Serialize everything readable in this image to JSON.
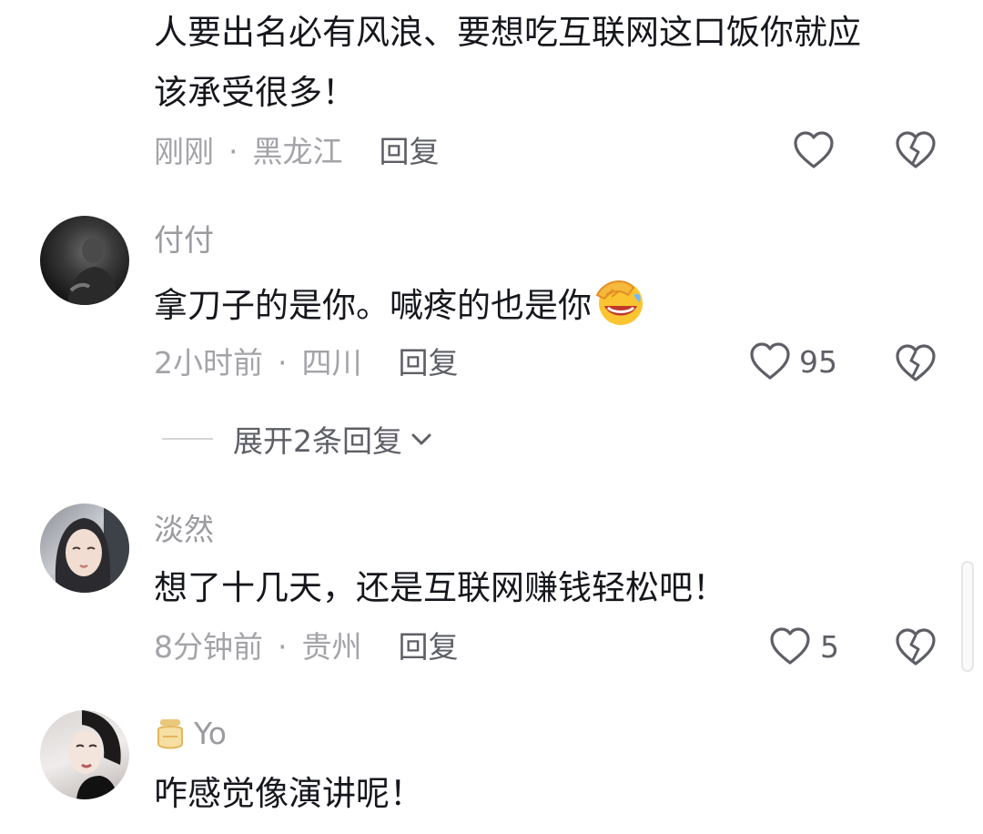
{
  "comments": [
    {
      "text_line1": "人要出名必有风浪、要想吃互联网这口饭你就应",
      "text_line2": "该承受很多！",
      "time": "刚刚",
      "location": "黑龙江",
      "reply_label": "回复"
    },
    {
      "username": "付付",
      "text": "拿刀子的是你。喊疼的也是你",
      "time": "2小时前",
      "location": "四川",
      "reply_label": "回复",
      "likes": "95",
      "expand_label": "展开2条回复"
    },
    {
      "username": "淡然",
      "text": "想了十几天，还是互联网赚钱轻松吧！",
      "time": "8分钟前",
      "location": "贵州",
      "reply_label": "回复",
      "likes": "5"
    },
    {
      "username": "Yo",
      "text": "咋感觉像演讲呢！"
    }
  ],
  "separator": "·",
  "icons": {
    "like": "heart-outline-icon",
    "dislike": "broken-heart-icon",
    "emoji": "facepalm-laugh-emoji",
    "badge": "honey-jar-badge-icon"
  },
  "colors": {
    "text": "#16171c",
    "secondary": "#a3a3a8",
    "reply": "#5e5f66"
  }
}
